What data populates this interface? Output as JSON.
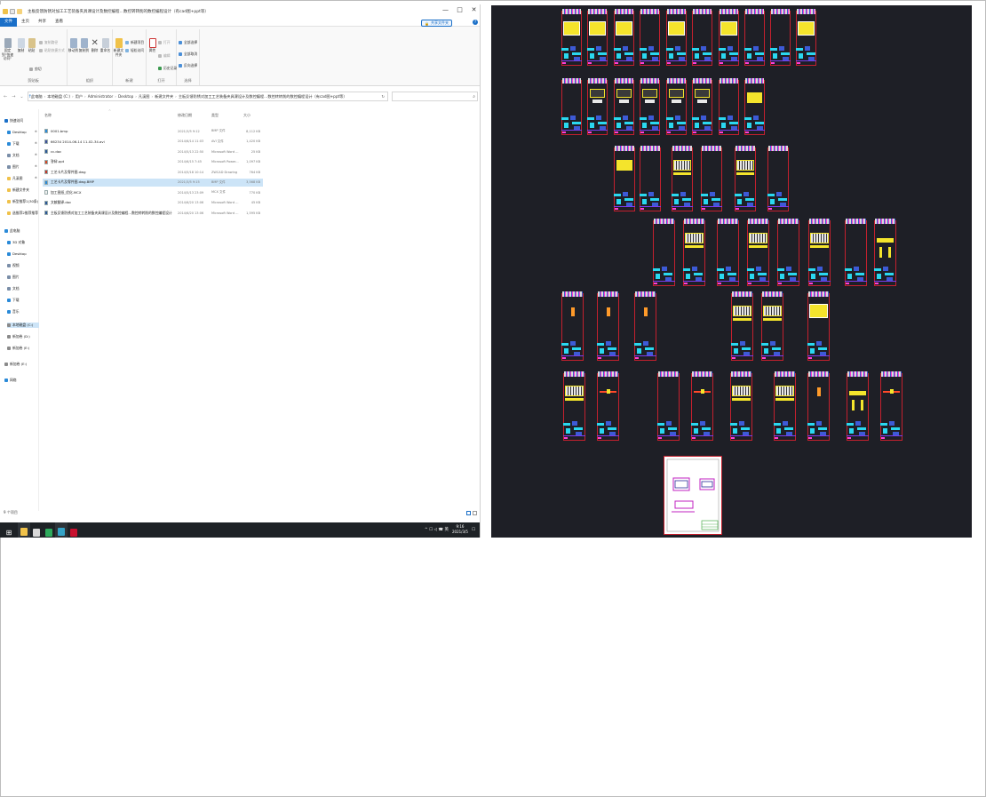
{
  "window": {
    "title": "主板反馈防锈对加工工艺装备夹具课设计及数控编程…数控转转削的数控编程设计（有cad图+ppt等）",
    "controls": {
      "minimize": "—",
      "maximize": "□",
      "close": "✕"
    }
  },
  "ribbon_tabs": [
    {
      "label": "文件"
    },
    {
      "label": "主页"
    },
    {
      "label": "共享"
    },
    {
      "label": "查看"
    }
  ],
  "share_badge": "共享文件夹",
  "ribbon": {
    "clipboard": {
      "group_label": "剪贴板",
      "pin_label": "固定到\"快速访问\"",
      "copy_label": "复制",
      "paste_label": "粘贴",
      "cut_label": "剪切",
      "copy_path_label": "复制路径",
      "paste_shortcut_label": "粘贴快捷方式"
    },
    "organize": {
      "group_label": "组织",
      "move_label": "移动到",
      "copy_to_label": "复制到",
      "delete_label": "删除",
      "rename_label": "重命名"
    },
    "new": {
      "group_label": "新建",
      "new_folder_label": "新建文件夹",
      "new_item_label": "新建项目",
      "easy_access_label": "轻松访问"
    },
    "open": {
      "group_label": "打开",
      "properties_label": "属性",
      "open_label": "打开",
      "edit_label": "编辑",
      "history_label": "历史记录"
    },
    "select": {
      "group_label": "选择",
      "select_all_label": "全部选择",
      "select_none_label": "全部取消",
      "invert_label": "反向选择"
    }
  },
  "nav": {
    "back": "←",
    "forward": "→",
    "recent": "⌄",
    "up": "↑",
    "breadcrumb": [
      "此电脑",
      "本地磁盘 (C:)",
      "用户",
      "Administrator",
      "Desktop",
      "凡溪图",
      "新建文件夹",
      "主板反馈防锈对加工工艺装备夹具课设计及数控编程…数控转转削的数控编程设计（有cad图+ppt等）"
    ],
    "refresh": "↻"
  },
  "nav_pane": [
    {
      "label": "快速访问",
      "color": "#1a6fc8",
      "indent": 0
    },
    {
      "label": "Desktop",
      "color": "#2a8ad8",
      "indent": 1
    },
    {
      "label": "下载",
      "color": "#2a8ad8",
      "indent": 1
    },
    {
      "label": "文档",
      "color": "#7a8ea8",
      "indent": 1
    },
    {
      "label": "图片",
      "color": "#7a8ea8",
      "indent": 1
    },
    {
      "label": "凡溪图",
      "color": "#f0c24a",
      "indent": 1
    },
    {
      "label": "新建文件夹",
      "color": "#f0c24a",
      "indent": 1
    },
    {
      "label": "新型推荐1(30条)",
      "color": "#f0c24a",
      "indent": 1
    },
    {
      "label": "选推荐2推荐推荐",
      "color": "#f0c24a",
      "indent": 1
    },
    {
      "label": "此电脑",
      "color": "#2a8ad8",
      "indent": 0
    },
    {
      "label": "3D 对象",
      "color": "#2a8ad8",
      "indent": 1
    },
    {
      "label": "Desktop",
      "color": "#2a8ad8",
      "indent": 1
    },
    {
      "label": "视频",
      "color": "#7a8ea8",
      "indent": 1
    },
    {
      "label": "图片",
      "color": "#7a8ea8",
      "indent": 1
    },
    {
      "label": "文档",
      "color": "#7a8ea8",
      "indent": 1
    },
    {
      "label": "下载",
      "color": "#2a8ad8",
      "indent": 1
    },
    {
      "label": "音乐",
      "color": "#2a8ad8",
      "indent": 1
    },
    {
      "label": "本地磁盘 (C:)",
      "color": "#8a8a8a",
      "indent": 1,
      "selected": true
    },
    {
      "label": "新加卷 (D:)",
      "color": "#8a8a8a",
      "indent": 1
    },
    {
      "label": "新加卷 (E:)",
      "color": "#8a8a8a",
      "indent": 1
    },
    {
      "label": "新加卷 (E:)",
      "color": "#8a8a8a",
      "indent": 0
    },
    {
      "label": "网络",
      "color": "#2a8ad8",
      "indent": 0
    }
  ],
  "columns": {
    "name": "名称",
    "date": "修改日期",
    "type": "类型",
    "size": "大小"
  },
  "files": [
    {
      "name": "0001.bmp",
      "date": "2021/3/5 9:12",
      "type": "BMP 文件",
      "size": "8,112 KB",
      "color": "#2a8ad8"
    },
    {
      "name": "66234 2014-06-14 11-02-34.avi",
      "date": "2014/6/14 11:03",
      "type": "AVI 文件",
      "size": "1,420 KB",
      "color": "#3d4f9a"
    },
    {
      "name": "cc.doc",
      "date": "2014/5/13 22:50",
      "type": "Microsoft Word ...",
      "size": "25 KB",
      "color": "#2b5797"
    },
    {
      "name": "答辩.ppt",
      "date": "2014/6/15 7:45",
      "type": "Microsoft Power...",
      "size": "1,097 KB",
      "color": "#d24726"
    },
    {
      "name": "工艺卡片及零件图.dwg",
      "date": "2014/5/18 10:14",
      "type": "ZWCAD Drawing",
      "size": "764 KB",
      "color": "#c0392b"
    },
    {
      "name": "工艺卡片及零件图.dwg.BMP",
      "date": "2021/3/5 9:15",
      "type": "BMP 文件",
      "size": "3,568 KB",
      "color": "#2a8ad8",
      "selected": true
    },
    {
      "name": "加工图纸_优化.MCX",
      "date": "2014/5/13 23:09",
      "type": "MCX 文件",
      "size": "770 KB",
      "color": "#f0f0f0"
    },
    {
      "name": "文献翻译.doc",
      "date": "2014/6/20 13:06",
      "type": "Microsoft Word ...",
      "size": "45 KB",
      "color": "#2b5797"
    },
    {
      "name": "主板反馈防锈对加工工艺装备夹具课设计及数控编程…数控转转削的数控编程设计（有cad图+ppt等）.d...",
      "date": "2014/6/20 13:06",
      "type": "Microsoft Word ...",
      "size": "1,595 KB",
      "color": "#2b5797"
    }
  ],
  "status": {
    "count": "9 个项目"
  },
  "taskbar": {
    "start": "⊞",
    "apps": [
      {
        "name": "explorer",
        "color": "#f0c24a",
        "active": true
      },
      {
        "name": "search",
        "color": "#d8d8d8"
      },
      {
        "name": "wps",
        "color": "#2eaa5c"
      },
      {
        "name": "zwcad",
        "color": "#34a3c7",
        "active": true
      },
      {
        "name": "autocad",
        "color": "#c8102e"
      }
    ],
    "tray_icons": "^ ☐ ◁ ☎ 英",
    "time": "9:16",
    "date": "2021/3/5",
    "notify": "☐"
  },
  "cad_view": {
    "background": "#1e1f26",
    "border_color": "#c4202e"
  }
}
